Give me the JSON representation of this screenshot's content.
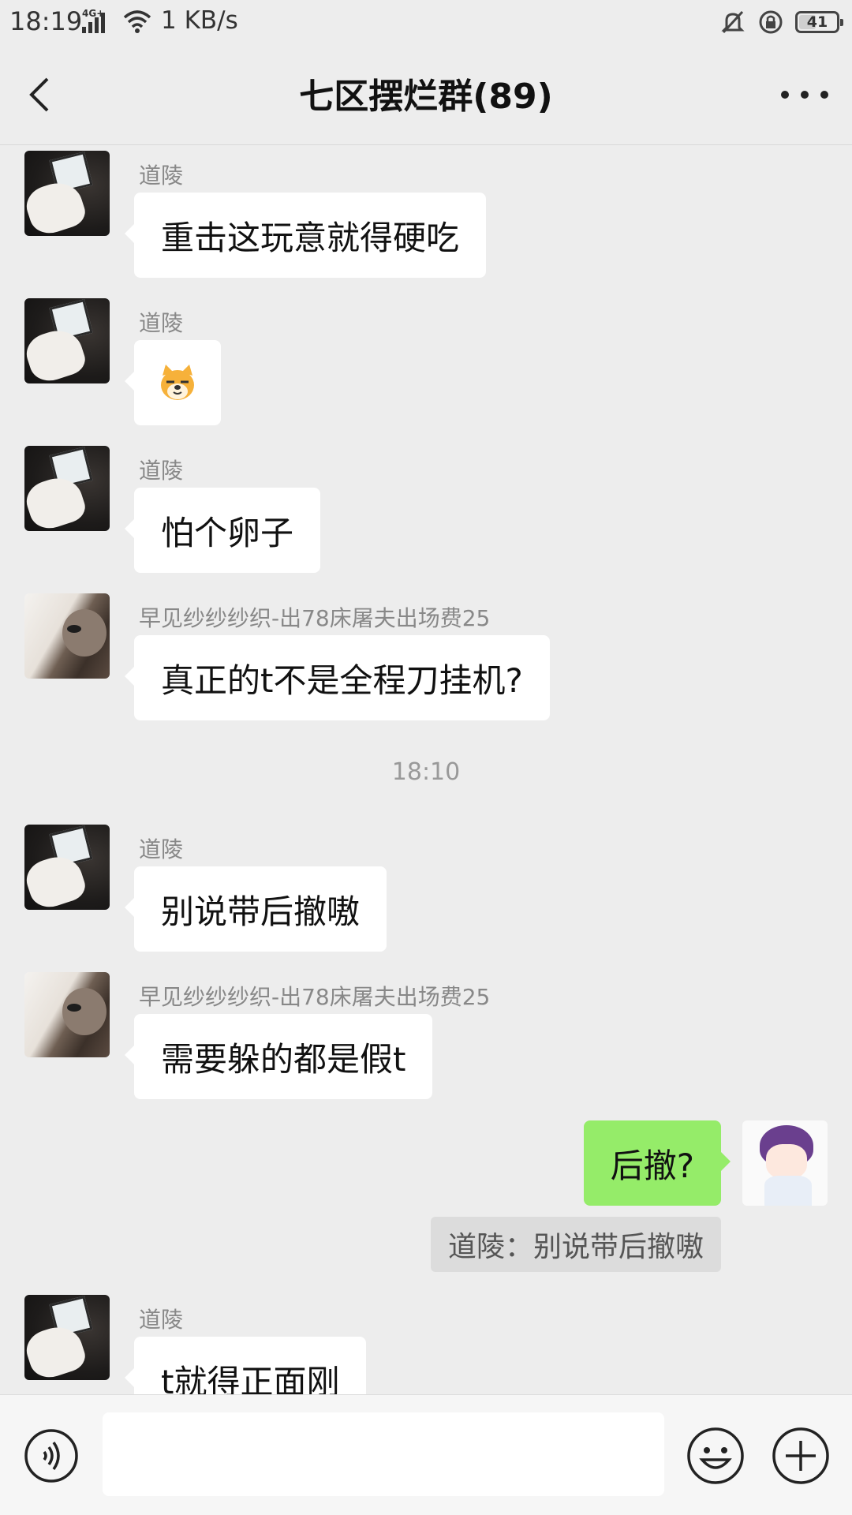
{
  "status_bar": {
    "time": "18:19",
    "network": "4G+",
    "speed": "1 KB/s",
    "battery": "41",
    "battery_level": 0.41,
    "icons": [
      "signal-icon",
      "wifi-icon",
      "mute-bell-icon",
      "rotation-lock-icon",
      "battery-icon"
    ]
  },
  "header": {
    "title": "七区摆烂群(89)",
    "back_icon": "chevron-left-icon",
    "more_icon": "more-dots-icon"
  },
  "messages": [
    {
      "sender": "道陵",
      "text": "重击这玩意就得硬吃",
      "avatar": "daoling-avatar"
    },
    {
      "sender": "道陵",
      "text": "",
      "sticker": "doge-emoji-icon",
      "avatar": "daoling-avatar"
    },
    {
      "sender": "道陵",
      "text": "怕个卵子",
      "avatar": "daoling-avatar"
    },
    {
      "sender": "早见纱纱纱织-出78床屠夫出场费25",
      "text": "真正的t不是全程刀挂机?",
      "avatar": "cat-avatar"
    },
    {
      "sender": "道陵",
      "text": "别说带后撤嗷",
      "avatar": "daoling-avatar"
    },
    {
      "sender": "早见纱纱纱织-出78床屠夫出场费25",
      "text": "需要躲的都是假t",
      "avatar": "cat-avatar"
    },
    {
      "sender": "",
      "text": "后撤?",
      "mine": true,
      "avatar": "anime-avatar"
    },
    {
      "sender": "道陵",
      "text": "t就得正面刚",
      "avatar": "daoling-avatar"
    }
  ],
  "time_separator": "18:10",
  "quote": "道陵：别说带后撤嗷",
  "colors": {
    "background": "#ededed",
    "my_bubble": "#95ec69",
    "other_bubble": "#ffffff",
    "quote_bg": "#dcdcdc"
  },
  "input_bar": {
    "value": "",
    "icons": [
      "voice-icon",
      "emoji-icon",
      "plus-icon"
    ]
  }
}
